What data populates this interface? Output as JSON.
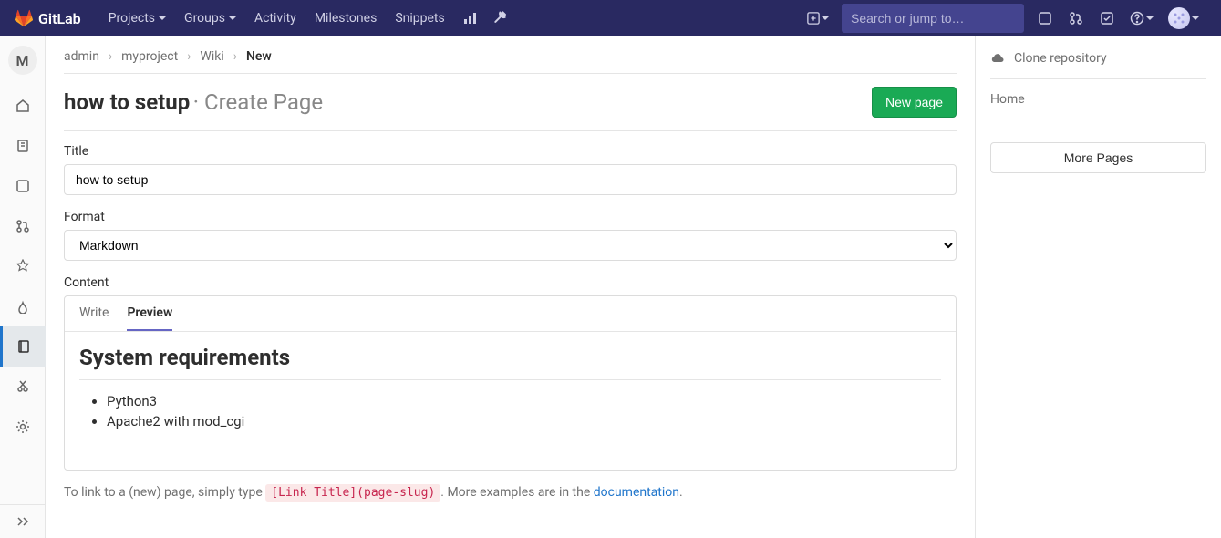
{
  "header": {
    "brand": "GitLab",
    "nav": {
      "projects": "Projects",
      "groups": "Groups",
      "activity": "Activity",
      "milestones": "Milestones",
      "snippets": "Snippets"
    },
    "search_placeholder": "Search or jump to…"
  },
  "sidebar": {
    "project_initial": "M"
  },
  "breadcrumb": {
    "admin": "admin",
    "project": "myproject",
    "wiki": "Wiki",
    "current": "New"
  },
  "page": {
    "title": "how to setup",
    "subtitle": "· Create Page",
    "new_page_button": "New page"
  },
  "form": {
    "title_label": "Title",
    "title_value": "how to setup",
    "format_label": "Format",
    "format_value": "Markdown",
    "content_label": "Content",
    "tab_write": "Write",
    "tab_preview": "Preview"
  },
  "preview": {
    "heading": "System requirements",
    "items": {
      "0": "Python3",
      "1": "Apache2 with mod_cgi"
    }
  },
  "help": {
    "prefix": "To link to a (new) page, simply type ",
    "code": "[Link Title](page-slug)",
    "mid": ". More examples are in the ",
    "link": "documentation",
    "suffix": "."
  },
  "rightpane": {
    "clone": "Clone repository",
    "home": "Home",
    "more_pages": "More Pages"
  }
}
